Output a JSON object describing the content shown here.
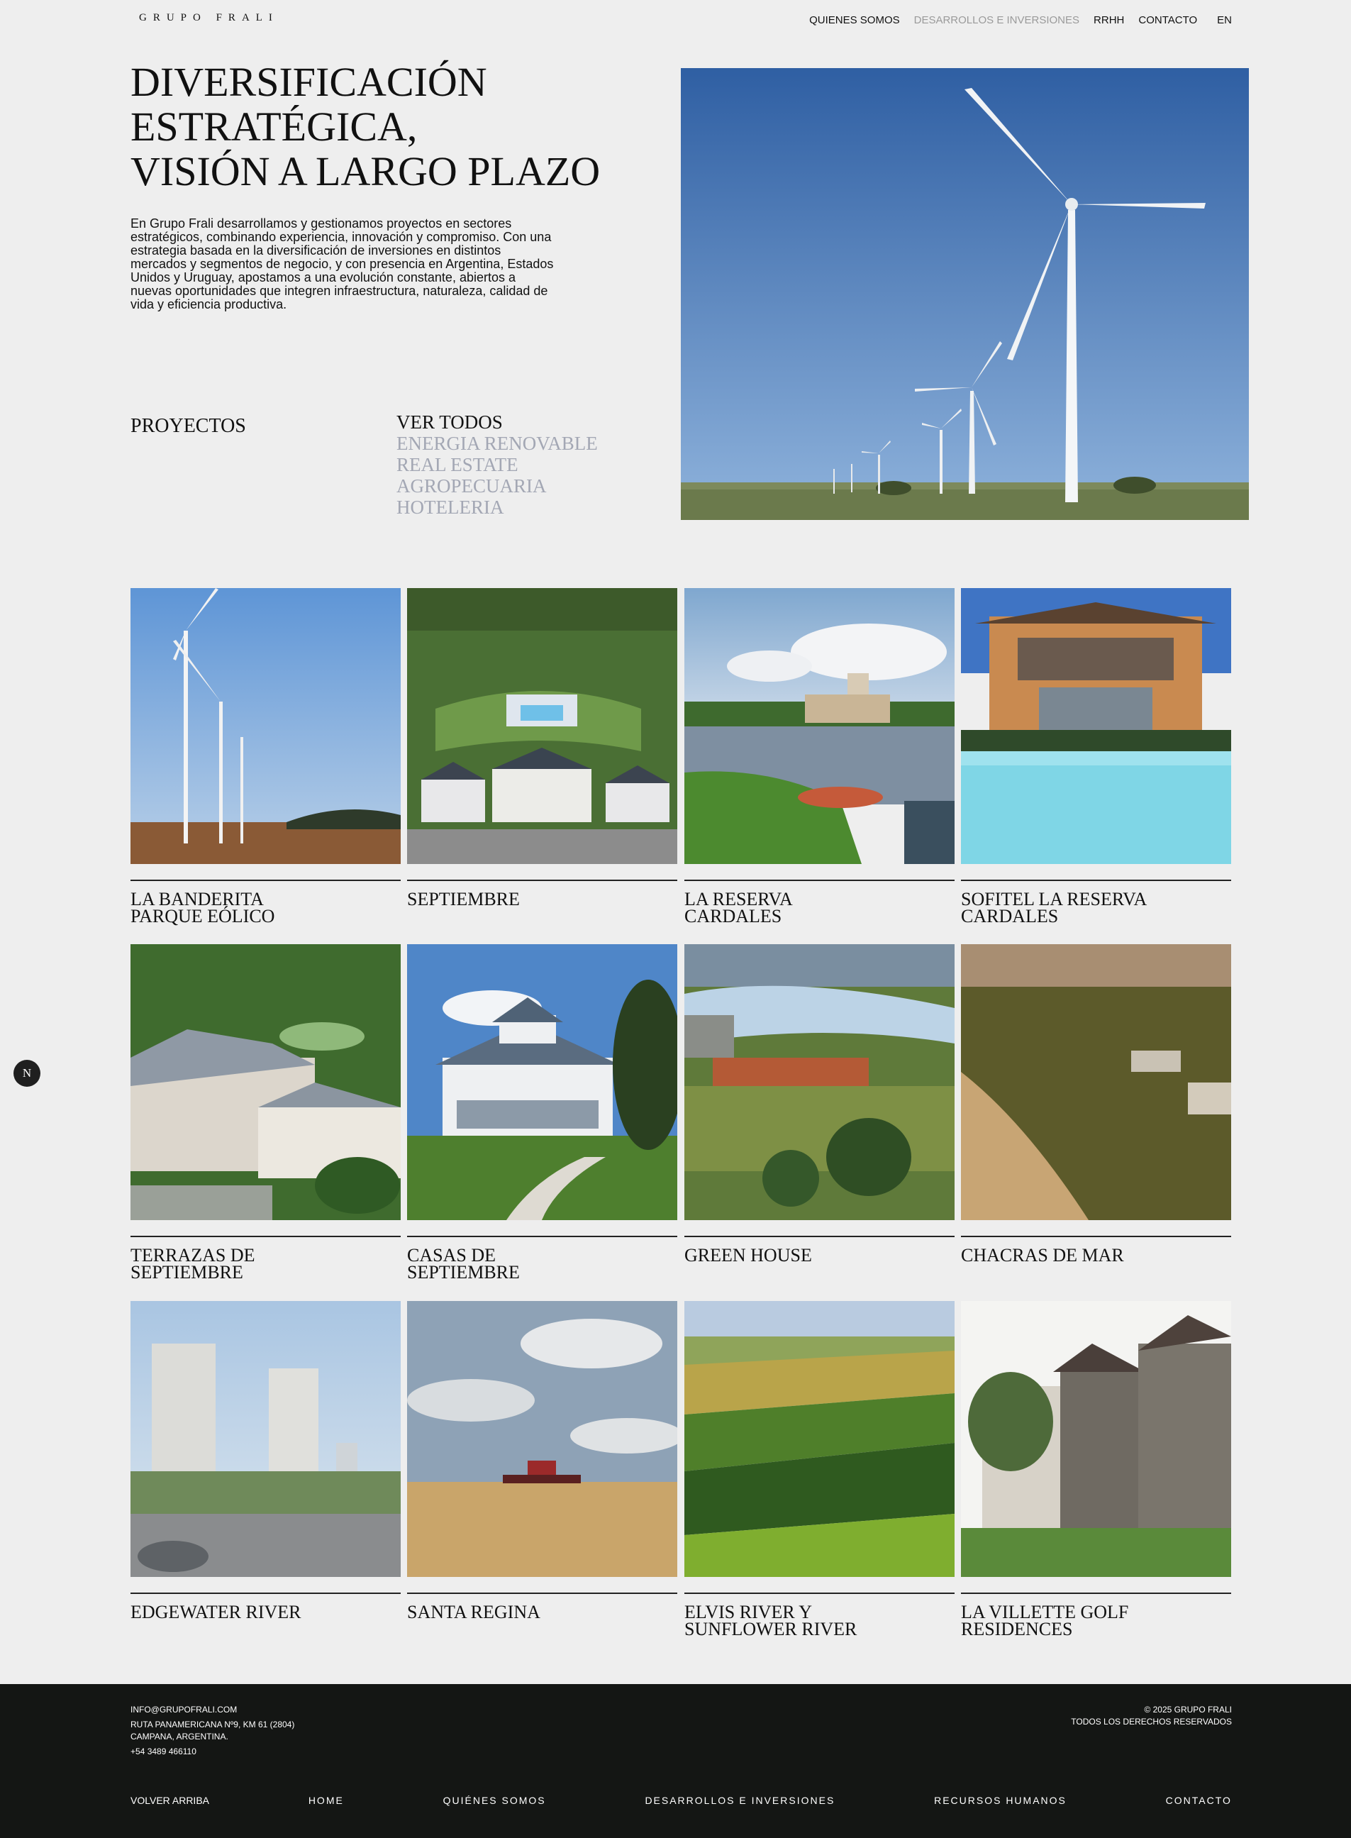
{
  "header": {
    "brand": "GRUPO FRALI",
    "nav": [
      {
        "label": "QUIENES SOMOS"
      },
      {
        "label": "DESARROLLOS E INVERSIONES"
      },
      {
        "label": "RRHH"
      },
      {
        "label": "CONTACTO"
      }
    ],
    "lang": "EN"
  },
  "hero": {
    "title_lines": [
      "DIVERSIFICACIÓN",
      "ESTRATÉGICA,",
      "VISIÓN A LARGO PLAZO"
    ],
    "text": "En Grupo Frali desarrollamos y gestionamos proyectos en sectores estratégicos, combinando experiencia, innovación y compromiso. Con una estrategia basada en la diversificación de inversiones en distintos mercados y segmentos de negocio, y con presencia en Argentina, Estados Unidos y Uruguay, apostamos a una evolución constante, abiertos a nuevas oportunidades que integren infraestructura, naturaleza, calidad de vida y eficiencia productiva."
  },
  "projects": {
    "label": "PROYECTOS",
    "filters": [
      "VER TODOS",
      "ENERGIA RENOVABLE",
      "REAL ESTATE",
      "AGROPECUARIA",
      "HOTELERIA"
    ],
    "items": [
      {
        "line1": "LA BANDERITA",
        "line2": "PARQUE EÓLICO"
      },
      {
        "line1": "SEPTIEMBRE",
        "line2": ""
      },
      {
        "line1": "LA RESERVA",
        "line2": "CARDALES"
      },
      {
        "line1": "SOFITEL LA RESERVA",
        "line2": "CARDALES"
      },
      {
        "line1": "TERRAZAS DE",
        "line2": "SEPTIEMBRE"
      },
      {
        "line1": "CASAS DE",
        "line2": "SEPTIEMBRE"
      },
      {
        "line1": "GREEN HOUSE",
        "line2": ""
      },
      {
        "line1": "CHACRAS DE MAR",
        "line2": ""
      },
      {
        "line1": "EDGEWATER RIVER",
        "line2": ""
      },
      {
        "line1": "SANTA REGINA",
        "line2": ""
      },
      {
        "line1": "ELVIS RIVER Y",
        "line2": "SUNFLOWER RIVER"
      },
      {
        "line1": "LA VILLETTE GOLF",
        "line2": "RESIDENCES"
      }
    ]
  },
  "badge": "N",
  "footer": {
    "email": "INFO@GRUPOFRALI.COM",
    "address1": "RUTA PANAMERICANA Nº9, KM 61 (2804)",
    "address2": "CAMPANA, ARGENTINA.",
    "phone": "+54 3489 466110",
    "copyright": "© 2025 GRUPO FRALI",
    "rights": "TODOS LOS DERECHOS RESERVADOS",
    "links": [
      "VOLVER ARRIBA",
      "HOME",
      "QUIÉNES SOMOS",
      "DESARROLLOS E INVERSIONES",
      "RECURSOS HUMANOS",
      "CONTACTO"
    ]
  },
  "colors": {
    "background": "#eeeeee",
    "footer": "#141614",
    "muted_nav": "#9a9a9a",
    "filter_muted": "#a3a7b4"
  }
}
